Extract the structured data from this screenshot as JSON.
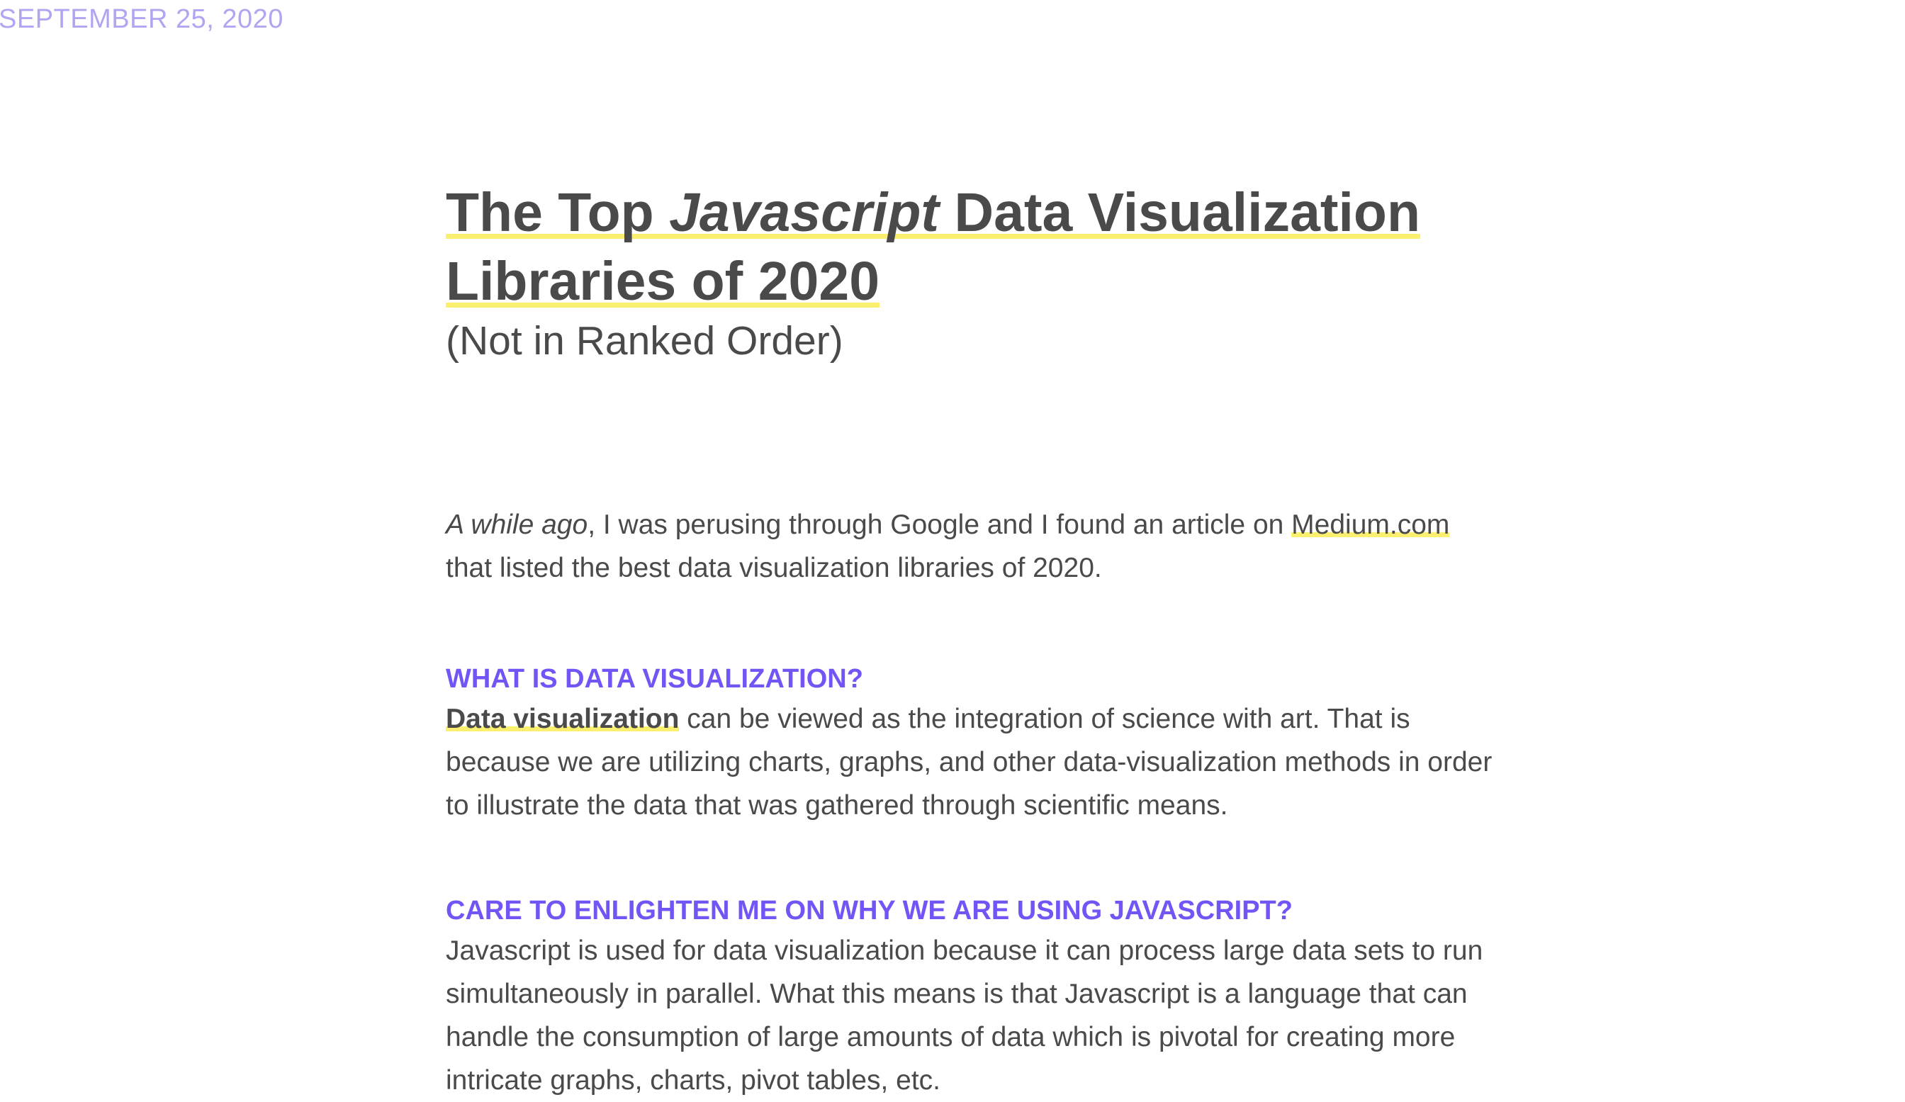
{
  "post": {
    "date": "SEPTEMBER 25, 2020"
  },
  "article": {
    "title": {
      "part1": "The Top ",
      "italic": "Javascript",
      "part2": " Data Visualization",
      "line2": "Libraries of 2020"
    },
    "subtitle": "(Not in Ranked Order)",
    "intro": {
      "italic_lead": "A while ago",
      "text1": ", I was perusing through Google and I found an article on ",
      "link_text": "Medium.com",
      "text2": " that listed the best data visualization libraries of 2020."
    },
    "sections": [
      {
        "heading": "WHAT IS DATA VISUALIZATION?",
        "link_text": "Data visualization",
        "body": " can be viewed as the integration of science with art. That is because we are utilizing charts, graphs, and other data-visualization methods in order to illustrate the data that was gathered through scientific means."
      },
      {
        "heading": "CARE TO ENLIGHTEN ME ON WHY WE ARE USING JAVASCRIPT?",
        "body": "Javascript is used for data visualization because it can process large data sets to run simultaneously in parallel. What this means is that Javascript is a language that can handle the consumption of large amounts of data which is pivotal for creating more intricate graphs, charts, pivot tables, etc."
      }
    ]
  },
  "colors": {
    "text": "#4a4a4a",
    "accent": "#7355f5",
    "date": "#b3a4f2",
    "highlight": "#fbef70"
  }
}
